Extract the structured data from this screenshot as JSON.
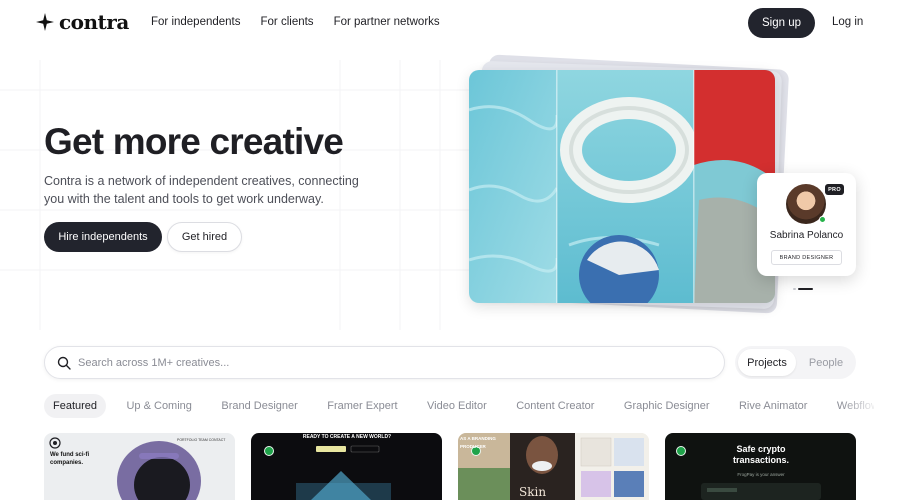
{
  "nav": {
    "logo_text": "contra",
    "links": [
      "For independents",
      "For clients",
      "For partner networks"
    ],
    "signup_label": "Sign up",
    "login_label": "Log in"
  },
  "hero": {
    "title": "Get more creative",
    "subtitle": "Contra is a network of independent creatives, connecting you with the talent and tools to get work underway.",
    "primary_cta": "Hire independents",
    "secondary_cta": "Get hired"
  },
  "profile_card": {
    "badge": "PRO",
    "name": "Sabrina Polanco",
    "role": "BRAND DESIGNER",
    "carousel_active_index": 1,
    "carousel_count": 2
  },
  "search": {
    "placeholder": "Search across 1M+ creatives...",
    "value": "",
    "toggle": [
      "Projects",
      "People"
    ],
    "toggle_selected": "Projects"
  },
  "categories": {
    "items": [
      "Featured",
      "Up & Coming",
      "Brand Designer",
      "Framer Expert",
      "Video Editor",
      "Content Creator",
      "Graphic Designer",
      "Rive Animator",
      "Webflow Partner"
    ],
    "selected": "Featured"
  },
  "projects": [
    {
      "headline": "We fund sci-fi companies.",
      "nav": "PORTFOLIO  TEAM  CONTACT"
    },
    {
      "headline": "READY TO CREATE A NEW WORLD?"
    },
    {
      "headline": "AS A BRANDING PRODUCER",
      "subtext": "Skin"
    },
    {
      "headline": "Safe crypto transactions.",
      "subtext": "FrogPay is your answer"
    }
  ],
  "colors": {
    "primary_dark": "#22242d",
    "accent_green": "#25b24a",
    "muted_text": "#8a8c95"
  }
}
